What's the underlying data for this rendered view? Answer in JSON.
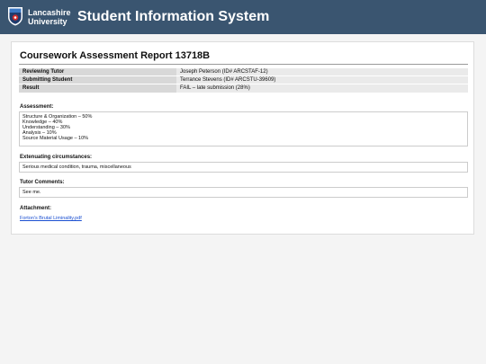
{
  "header": {
    "university_line1": "Lancashire",
    "university_line2": "University",
    "system_title": "Student Information System",
    "brand_color": "#3a5570"
  },
  "report": {
    "title": "Coursework Assessment Report 13718B",
    "info_rows": [
      {
        "label": "Reviewing Tutor",
        "value": "Joseph Peterson (ID# ARCSTAF-12)"
      },
      {
        "label": "Submitting Student",
        "value": "Terrance Stevens (ID# ARCSTU-39609)"
      },
      {
        "label": "Result",
        "value": "FAIL – late submission (28%)"
      }
    ],
    "assessment": {
      "label": "Assessment:",
      "lines": [
        "Structure & Organization – 50%",
        "Knowledge – 40%",
        "Understanding – 30%",
        "Analysis – 10%",
        "Source Material Usage – 10%"
      ]
    },
    "extenuating": {
      "label": "Extenuating circumstances:",
      "text": "Serious medical condition, trauma, miscellaneous"
    },
    "tutor_comments": {
      "label": "Tutor Comments:",
      "text": "See me."
    },
    "attachment": {
      "label": "Attachment:",
      "filename": "Forton's Brutal Liminality.pdf"
    }
  }
}
